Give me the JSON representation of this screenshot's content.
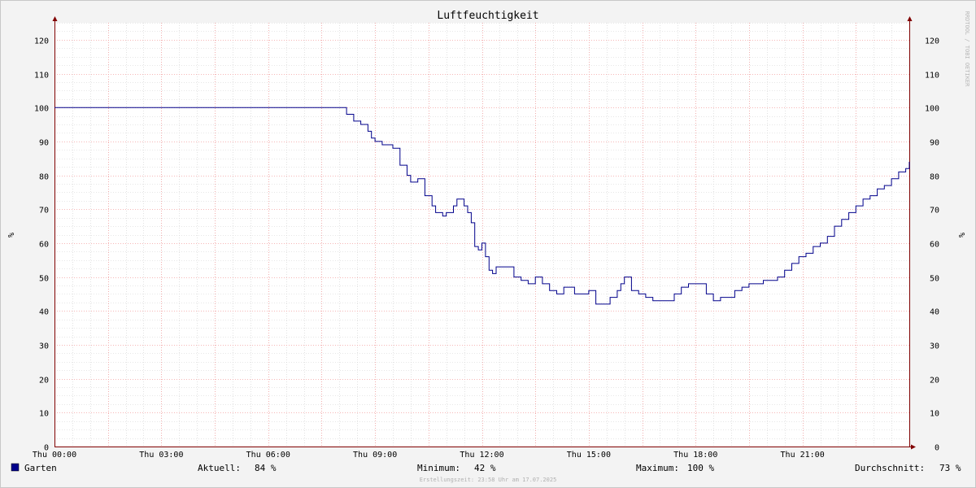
{
  "chart_data": {
    "type": "line",
    "title": "Luftfeuchtigkeit",
    "ylabel": "%",
    "ylim": [
      0,
      125
    ],
    "yticks": [
      0,
      10,
      20,
      30,
      40,
      50,
      60,
      70,
      80,
      90,
      100,
      110,
      120
    ],
    "xlim": [
      0,
      24
    ],
    "xticks": [
      {
        "x": 0,
        "label": "Thu 00:00"
      },
      {
        "x": 3,
        "label": "Thu 03:00"
      },
      {
        "x": 6,
        "label": "Thu 06:00"
      },
      {
        "x": 9,
        "label": "Thu 09:00"
      },
      {
        "x": 12,
        "label": "Thu 12:00"
      },
      {
        "x": 15,
        "label": "Thu 15:00"
      },
      {
        "x": 18,
        "label": "Thu 18:00"
      },
      {
        "x": 21,
        "label": "Thu 21:00"
      }
    ],
    "grid": true,
    "series": [
      {
        "name": "Garten",
        "color": "#00008b",
        "x": [
          0,
          8.1,
          8.2,
          8.4,
          8.6,
          8.8,
          8.9,
          9.0,
          9.2,
          9.3,
          9.5,
          9.7,
          9.9,
          10.0,
          10.2,
          10.4,
          10.6,
          10.7,
          10.9,
          11.0,
          11.2,
          11.3,
          11.5,
          11.6,
          11.7,
          11.8,
          11.9,
          12.0,
          12.1,
          12.2,
          12.3,
          12.4,
          12.6,
          12.8,
          12.9,
          13.1,
          13.3,
          13.5,
          13.7,
          13.9,
          14.1,
          14.3,
          14.6,
          14.8,
          15.0,
          15.2,
          15.4,
          15.6,
          15.8,
          15.9,
          16.0,
          16.2,
          16.4,
          16.6,
          16.8,
          17.0,
          17.2,
          17.4,
          17.6,
          17.8,
          18.0,
          18.2,
          18.3,
          18.5,
          18.7,
          18.9,
          19.1,
          19.3,
          19.5,
          19.7,
          19.9,
          20.1,
          20.3,
          20.5,
          20.7,
          20.9,
          21.1,
          21.3,
          21.5,
          21.7,
          21.9,
          22.1,
          22.3,
          22.5,
          22.7,
          22.9,
          23.1,
          23.3,
          23.5,
          23.7,
          23.9,
          24.0
        ],
        "y": [
          100,
          100,
          98,
          96,
          95,
          93,
          91,
          90,
          89,
          89,
          88,
          83,
          80,
          78,
          79,
          74,
          71,
          69,
          68,
          69,
          71,
          73,
          71,
          69,
          66,
          59,
          58,
          60,
          56,
          52,
          51,
          53,
          53,
          53,
          50,
          49,
          48,
          50,
          48,
          46,
          45,
          47,
          45,
          45,
          46,
          42,
          42,
          44,
          46,
          48,
          50,
          46,
          45,
          44,
          43,
          43,
          43,
          45,
          47,
          48,
          48,
          48,
          45,
          43,
          44,
          44,
          46,
          47,
          48,
          48,
          49,
          49,
          50,
          52,
          54,
          56,
          57,
          59,
          60,
          62,
          65,
          67,
          69,
          71,
          73,
          74,
          76,
          77,
          79,
          81,
          82,
          84
        ]
      }
    ]
  },
  "legend": {
    "name": "Garten",
    "current_label": "Aktuell:",
    "current_value": "84 %",
    "min_label": "Minimum:",
    "min_value": "42 %",
    "max_label": "Maximum:",
    "max_value": "100 %",
    "avg_label": "Durchschnitt:",
    "avg_value": "73 %"
  },
  "footer": "Erstellungszeit: 23:58 Uhr am 17.07.2025",
  "watermark": "RRDTOOL / TOBI OETIKER",
  "colors": {
    "background": "#f3f3f3",
    "canvas": "#ffffff",
    "major_grid": "#f4a0a0",
    "minor_grid": "#d0d0d0",
    "axis": "#800000",
    "line": "#00008b"
  }
}
